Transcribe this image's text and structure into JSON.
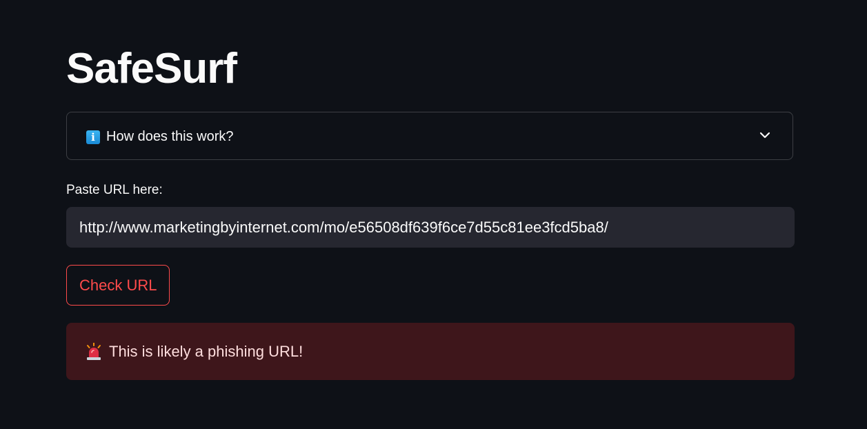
{
  "app": {
    "title": "SafeSurf"
  },
  "expander": {
    "label": "How does this work?",
    "icon": "info-icon",
    "toggle_icon": "chevron-down-icon",
    "expanded": false
  },
  "url_field": {
    "label": "Paste URL here:",
    "value": "http://www.marketingbyinternet.com/mo/e56508df639f6ce7d55c81ee3fcd5ba8/"
  },
  "check_button": {
    "label": "Check URL"
  },
  "result": {
    "icon": "siren-icon",
    "message": "This is likely a phishing URL!",
    "status": "error"
  },
  "colors": {
    "background": "#0e1117",
    "accent": "#ff4b4b",
    "alert_background": "#3e2328",
    "input_background": "#262730"
  }
}
